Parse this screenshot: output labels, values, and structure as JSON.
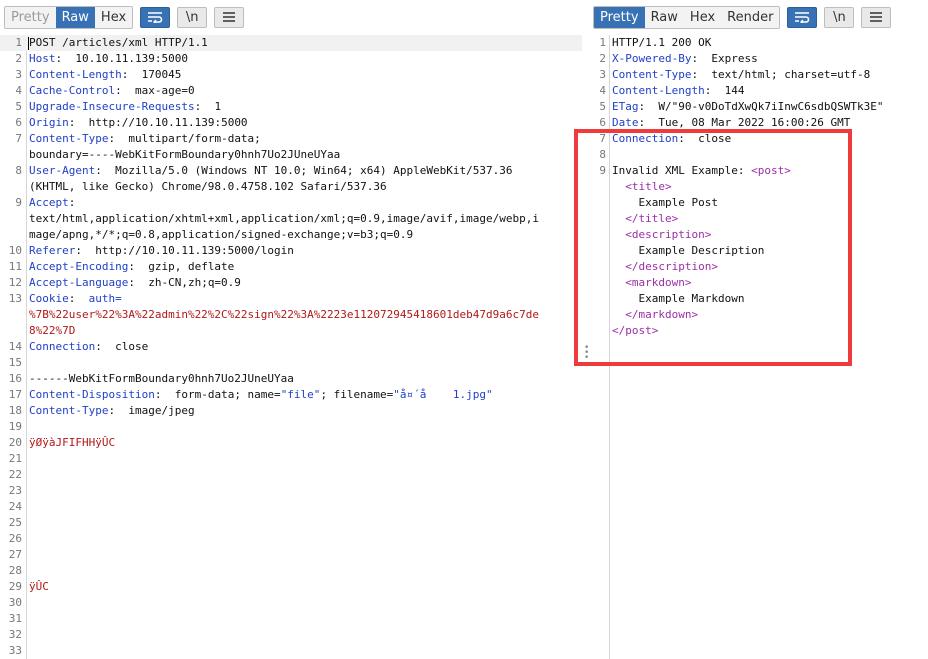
{
  "request_toolbar": {
    "tabs": [
      "Pretty",
      "Raw",
      "Hex"
    ],
    "active": "Raw",
    "wrap_icon": "wrap-lines-icon",
    "newline_label": "\\n",
    "menu_icon": "hamburger-menu-icon"
  },
  "response_toolbar": {
    "tabs": [
      "Pretty",
      "Raw",
      "Hex",
      "Render"
    ],
    "active": "Pretty",
    "wrap_icon": "wrap-lines-icon",
    "newline_label": "\\n",
    "menu_icon": "hamburger-menu-icon"
  },
  "request_lines": [
    {
      "n": "1",
      "parts": [
        {
          "t": "POST /articles/xml HTTP/1.1",
          "c": "v"
        }
      ]
    },
    {
      "n": "2",
      "parts": [
        {
          "t": "Host",
          "c": "k"
        },
        {
          "t": ":  10.10.11.139:5000",
          "c": "v"
        }
      ]
    },
    {
      "n": "3",
      "parts": [
        {
          "t": "Content-Length",
          "c": "k"
        },
        {
          "t": ":  170045",
          "c": "v"
        }
      ]
    },
    {
      "n": "4",
      "parts": [
        {
          "t": "Cache-Control",
          "c": "k"
        },
        {
          "t": ":  max-age=0",
          "c": "v"
        }
      ]
    },
    {
      "n": "5",
      "parts": [
        {
          "t": "Upgrade-Insecure-Requests",
          "c": "k"
        },
        {
          "t": ":  1",
          "c": "v"
        }
      ]
    },
    {
      "n": "6",
      "parts": [
        {
          "t": "Origin",
          "c": "k"
        },
        {
          "t": ":  http://10.10.11.139:5000",
          "c": "v"
        }
      ]
    },
    {
      "n": "7",
      "parts": [
        {
          "t": "Content-Type",
          "c": "k"
        },
        {
          "t": ":  multipart/form-data;",
          "c": "v"
        }
      ]
    },
    {
      "n": "",
      "parts": [
        {
          "t": "boundary=----WebKitFormBoundary0hnh7Uo2JUneUYaa",
          "c": "v"
        }
      ]
    },
    {
      "n": "8",
      "parts": [
        {
          "t": "User-Agent",
          "c": "k"
        },
        {
          "t": ":  Mozilla/5.0 (Windows NT 10.0; Win64; x64) AppleWebKit/537.36",
          "c": "v"
        }
      ]
    },
    {
      "n": "",
      "parts": [
        {
          "t": "(KHTML, like Gecko) Chrome/98.0.4758.102 Safari/537.36",
          "c": "v"
        }
      ]
    },
    {
      "n": "9",
      "parts": [
        {
          "t": "Accept",
          "c": "k"
        },
        {
          "t": ":",
          "c": "v"
        }
      ]
    },
    {
      "n": "",
      "parts": [
        {
          "t": "text/html,application/xhtml+xml,application/xml;q=0.9,image/avif,image/webp,i",
          "c": "v"
        }
      ]
    },
    {
      "n": "",
      "parts": [
        {
          "t": "mage/apng,*/*;q=0.8,application/signed-exchange;v=b3;q=0.9",
          "c": "v"
        }
      ]
    },
    {
      "n": "10",
      "parts": [
        {
          "t": "Referer",
          "c": "k"
        },
        {
          "t": ":  http://10.10.11.139:5000/login",
          "c": "v"
        }
      ]
    },
    {
      "n": "11",
      "parts": [
        {
          "t": "Accept-Encoding",
          "c": "k"
        },
        {
          "t": ":  gzip, deflate",
          "c": "v"
        }
      ]
    },
    {
      "n": "12",
      "parts": [
        {
          "t": "Accept-Language",
          "c": "k"
        },
        {
          "t": ":  zh-CN,zh;q=0.9",
          "c": "v"
        }
      ]
    },
    {
      "n": "13",
      "parts": [
        {
          "t": "Cookie",
          "c": "k"
        },
        {
          "t": ":  ",
          "c": "v"
        },
        {
          "t": "auth=",
          "c": "k"
        }
      ]
    },
    {
      "n": "",
      "parts": [
        {
          "t": "%7B%22user%22%3A%22admin%22%2C%22sign%22%3A%2223e112072945418601deb47d9a6c7de",
          "c": "red"
        }
      ]
    },
    {
      "n": "",
      "parts": [
        {
          "t": "8%22%7D",
          "c": "red"
        }
      ]
    },
    {
      "n": "14",
      "parts": [
        {
          "t": "Connection",
          "c": "k"
        },
        {
          "t": ":  close",
          "c": "v"
        }
      ]
    },
    {
      "n": "15",
      "parts": []
    },
    {
      "n": "16",
      "parts": [
        {
          "t": "------WebKitFormBoundary0hnh7Uo2JUneUYaa",
          "c": "v"
        }
      ]
    },
    {
      "n": "17",
      "parts": [
        {
          "t": "Content-Disposition",
          "c": "k"
        },
        {
          "t": ":  form-data; name=",
          "c": "v"
        },
        {
          "t": "\"file\"",
          "c": "str"
        },
        {
          "t": "; filename=",
          "c": "v"
        },
        {
          "t": "\"å¤´å    1.jpg\"",
          "c": "str"
        }
      ]
    },
    {
      "n": "18",
      "parts": [
        {
          "t": "Content-Type",
          "c": "k"
        },
        {
          "t": ":  image/jpeg",
          "c": "v"
        }
      ]
    },
    {
      "n": "19",
      "parts": []
    },
    {
      "n": "20",
      "parts": [
        {
          "t": "ÿØÿàJFIFHHÿÛC",
          "c": "red"
        }
      ]
    },
    {
      "n": "21",
      "parts": []
    },
    {
      "n": "22",
      "parts": []
    },
    {
      "n": "23",
      "parts": []
    },
    {
      "n": "24",
      "parts": []
    },
    {
      "n": "25",
      "parts": []
    },
    {
      "n": "26",
      "parts": []
    },
    {
      "n": "27",
      "parts": []
    },
    {
      "n": "28",
      "parts": []
    },
    {
      "n": "29",
      "parts": [
        {
          "t": "ÿÛC",
          "c": "red"
        }
      ]
    },
    {
      "n": "30",
      "parts": []
    },
    {
      "n": "31",
      "parts": []
    },
    {
      "n": "32",
      "parts": []
    },
    {
      "n": "33",
      "parts": []
    }
  ],
  "response_lines": [
    {
      "n": "1",
      "parts": [
        {
          "t": "HTTP/1.1 200 OK",
          "c": "v"
        }
      ]
    },
    {
      "n": "2",
      "parts": [
        {
          "t": "X-Powered-By",
          "c": "k"
        },
        {
          "t": ":  Express",
          "c": "v"
        }
      ]
    },
    {
      "n": "3",
      "parts": [
        {
          "t": "Content-Type",
          "c": "k"
        },
        {
          "t": ":  text/html; charset=utf-8",
          "c": "v"
        }
      ]
    },
    {
      "n": "4",
      "parts": [
        {
          "t": "Content-Length",
          "c": "k"
        },
        {
          "t": ":  144",
          "c": "v"
        }
      ]
    },
    {
      "n": "5",
      "parts": [
        {
          "t": "ETag",
          "c": "k"
        },
        {
          "t": ":  W/\"90-v0DoTdXwQk7iInwC6sdbQSWTk3E\"",
          "c": "v"
        }
      ]
    },
    {
      "n": "6",
      "parts": [
        {
          "t": "Date",
          "c": "k"
        },
        {
          "t": ":  Tue, 08 Mar 2022 16:00:26 GMT",
          "c": "v"
        }
      ]
    },
    {
      "n": "7",
      "parts": [
        {
          "t": "Connection",
          "c": "k"
        },
        {
          "t": ":  close",
          "c": "v"
        }
      ]
    },
    {
      "n": "8",
      "parts": []
    },
    {
      "n": "9",
      "parts": [
        {
          "t": "Invalid XML Example: ",
          "c": "v"
        },
        {
          "t": "<post>",
          "c": "tag"
        }
      ]
    },
    {
      "n": "",
      "parts": [
        {
          "t": "  ",
          "c": "v"
        },
        {
          "t": "<title>",
          "c": "tag"
        }
      ]
    },
    {
      "n": "",
      "parts": [
        {
          "t": "    Example Post",
          "c": "v"
        }
      ]
    },
    {
      "n": "",
      "parts": [
        {
          "t": "  ",
          "c": "v"
        },
        {
          "t": "</title>",
          "c": "tag"
        }
      ]
    },
    {
      "n": "",
      "parts": [
        {
          "t": "  ",
          "c": "v"
        },
        {
          "t": "<description>",
          "c": "tag"
        }
      ]
    },
    {
      "n": "",
      "parts": [
        {
          "t": "    Example Description",
          "c": "v"
        }
      ]
    },
    {
      "n": "",
      "parts": [
        {
          "t": "  ",
          "c": "v"
        },
        {
          "t": "</description>",
          "c": "tag"
        }
      ]
    },
    {
      "n": "",
      "parts": [
        {
          "t": "  ",
          "c": "v"
        },
        {
          "t": "<markdown>",
          "c": "tag"
        }
      ]
    },
    {
      "n": "",
      "parts": [
        {
          "t": "    Example Markdown",
          "c": "v"
        }
      ]
    },
    {
      "n": "",
      "parts": [
        {
          "t": "  ",
          "c": "v"
        },
        {
          "t": "</markdown>",
          "c": "tag"
        }
      ]
    },
    {
      "n": "",
      "parts": [
        {
          "t": "</post>",
          "c": "tag"
        }
      ]
    }
  ],
  "annotation": {
    "highlight_color": "#ef3b3b"
  },
  "colors": {
    "active_tab": "#3872b5",
    "header_name": "#1f3fc8",
    "binary": "#b21818",
    "xml_tag": "#9b2fa7"
  }
}
